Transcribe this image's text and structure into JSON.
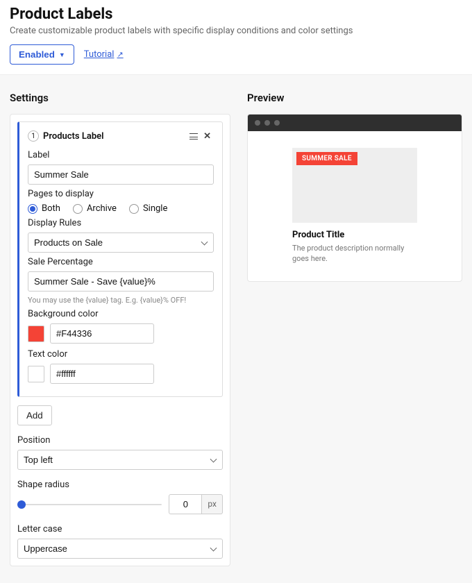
{
  "header": {
    "title": "Product Labels",
    "subtitle": "Create customizable product labels with specific display conditions and color settings",
    "enabled_label": "Enabled",
    "tutorial_label": "Tutorial"
  },
  "sections": {
    "settings": "Settings",
    "preview": "Preview"
  },
  "card": {
    "number": "1",
    "title": "Products Label",
    "label_label": "Label",
    "label_value": "Summer Sale",
    "pages_label": "Pages to display",
    "pages_options": {
      "both": "Both",
      "archive": "Archive",
      "single": "Single"
    },
    "rules_label": "Display Rules",
    "rules_value": "Products on Sale",
    "sale_pct_label": "Sale Percentage",
    "sale_pct_value": "Summer Sale - Save {value}%",
    "sale_pct_note": "You may use the {value} tag. E.g. {value}% OFF!",
    "bgcolor_label": "Background color",
    "bgcolor_value": "#F44336",
    "textcolor_label": "Text color",
    "textcolor_value": "#ffffff"
  },
  "add_label": "Add",
  "position": {
    "label": "Position",
    "value": "Top left"
  },
  "shape_radius": {
    "label": "Shape radius",
    "value": "0",
    "unit": "px"
  },
  "letter_case": {
    "label": "Letter case",
    "value": "Uppercase"
  },
  "preview": {
    "badge_text": "SUMMER SALE",
    "title": "Product Title",
    "desc": "The product description normally goes here."
  }
}
